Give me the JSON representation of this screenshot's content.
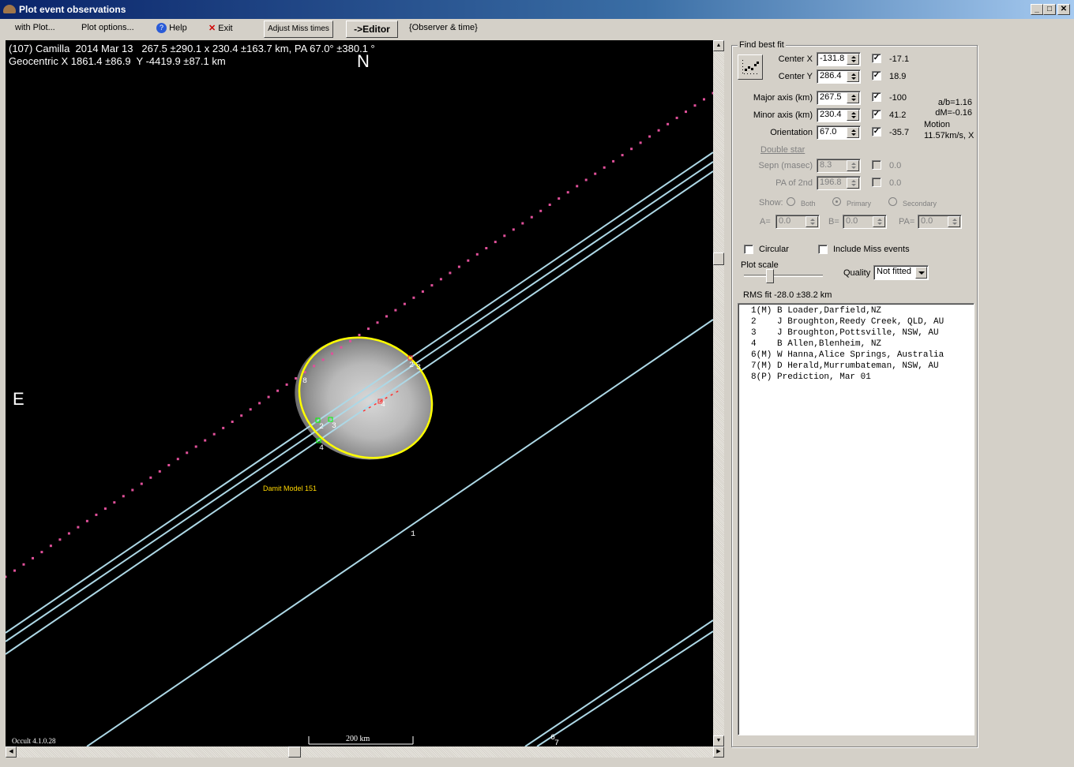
{
  "window": {
    "title": "Plot event observations",
    "controls": {
      "minimize": "_",
      "maximize": "□",
      "close": "✕"
    }
  },
  "menu": {
    "with_plot": "with Plot...",
    "plot_options": "Plot options...",
    "help": "Help",
    "exit": "Exit",
    "adjust_miss": "Adjust Miss times",
    "editor": "->Editor",
    "observer_time": "{Observer & time}"
  },
  "plot": {
    "header_line1": "(107) Camilla  2014 Mar 13   267.5 ±290.1 x 230.4 ±163.7 km, PA 67.0° ±380.1 °",
    "header_line2": "Geocentric X 1861.4 ±86.9  Y -4419.9 ±87.1 km",
    "north": "N",
    "east": "E",
    "model_label": "Damit Model 151",
    "version": "Occult 4.1.0.28",
    "scale_label": "200 km",
    "colors": {
      "background": "#000000",
      "chord": "#add8e6",
      "ellipse": "#ffff00",
      "prediction": "#e0509a",
      "model_label": "#ffd700",
      "disappear": "#00ff00",
      "reappear": "#ff3030"
    },
    "chord_labels": [
      "1",
      "2",
      "3",
      "4",
      "6",
      "7",
      "8"
    ]
  },
  "fit": {
    "group_label": "Find best fit",
    "center_x": {
      "label": "Center X",
      "value": "-131.8",
      "checked": true,
      "adj": "-17.1"
    },
    "center_y": {
      "label": "Center Y",
      "value": "286.4",
      "checked": true,
      "adj": "18.9"
    },
    "major": {
      "label": "Major axis (km)",
      "value": "267.5",
      "checked": true,
      "adj": "-100"
    },
    "minor": {
      "label": "Minor axis (km)",
      "value": "230.4",
      "checked": true,
      "adj": "41.2"
    },
    "orient": {
      "label": "Orientation",
      "value": "67.0",
      "checked": true,
      "adj": "-35.7"
    },
    "ab": "a/b=1.16",
    "dm": "dM=-0.16",
    "motion_label": "Motion",
    "motion_value": "11.57km/s, X",
    "double_star": "Double star",
    "sepn": {
      "label": "Sepn (masec)",
      "value": "8.3",
      "adj": "0.0"
    },
    "pa2": {
      "label": "PA of 2nd",
      "value": "196.8",
      "adj": "0.0"
    },
    "show_label": "Show:",
    "show_both": "Both",
    "show_primary": "Primary",
    "show_secondary": "Secondary",
    "a_label": "A=",
    "a_value": "0.0",
    "b_label": "B=",
    "b_value": "0.0",
    "pa_label": "PA=",
    "pa_value": "0.0",
    "circular": "Circular",
    "include_miss": "Include Miss events",
    "plot_scale": "Plot scale",
    "quality_label": "Quality",
    "quality_value": "Not fitted",
    "rms": "RMS fit -28.0 ±38.2 km"
  },
  "observers": [
    "1(M) B Loader,Darfield,NZ",
    "2    J Broughton,Reedy Creek, QLD, AU",
    "3    J Broughton,Pottsville, NSW, AU",
    "4    B Allen,Blenheim, NZ",
    "6(M) W Hanna,Alice Springs, Australia",
    "7(M) D Herald,Murrumbateman, NSW, AU",
    "8(P) Prediction, Mar 01"
  ]
}
